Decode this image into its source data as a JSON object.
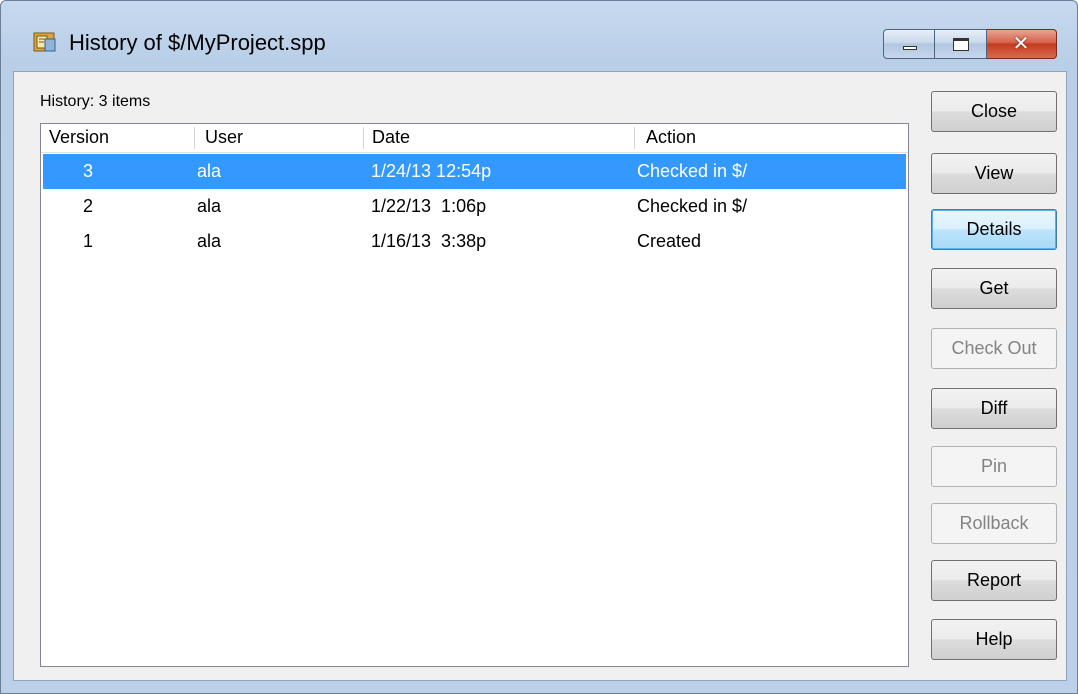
{
  "window": {
    "title": "History of $/MyProject.spp"
  },
  "history": {
    "count_label": "History: 3 items",
    "columns": [
      "Version",
      "User",
      "Date",
      "Action"
    ],
    "rows": [
      {
        "version": "3",
        "user": "ala",
        "date": "1/24/13 12:54p",
        "action": "Checked in $/",
        "selected": true
      },
      {
        "version": "2",
        "user": "ala",
        "date": "1/22/13  1:06p",
        "action": "Checked in $/",
        "selected": false
      },
      {
        "version": "1",
        "user": "ala",
        "date": "1/16/13  3:38p",
        "action": "Created",
        "selected": false
      }
    ]
  },
  "buttons": {
    "close": "Close",
    "view": "View",
    "details": "Details",
    "get": "Get",
    "check_out": "Check Out",
    "diff": "Diff",
    "pin": "Pin",
    "rollback": "Rollback",
    "report": "Report",
    "help": "Help"
  },
  "icons": {
    "app": "history-window-icon",
    "minimize": "minimize-icon",
    "maximize": "maximize-icon",
    "close": "close-icon"
  },
  "colors": {
    "selection": "#3399ff",
    "titlebar": "#b9cfe8",
    "close_button": "#c43b1e"
  }
}
